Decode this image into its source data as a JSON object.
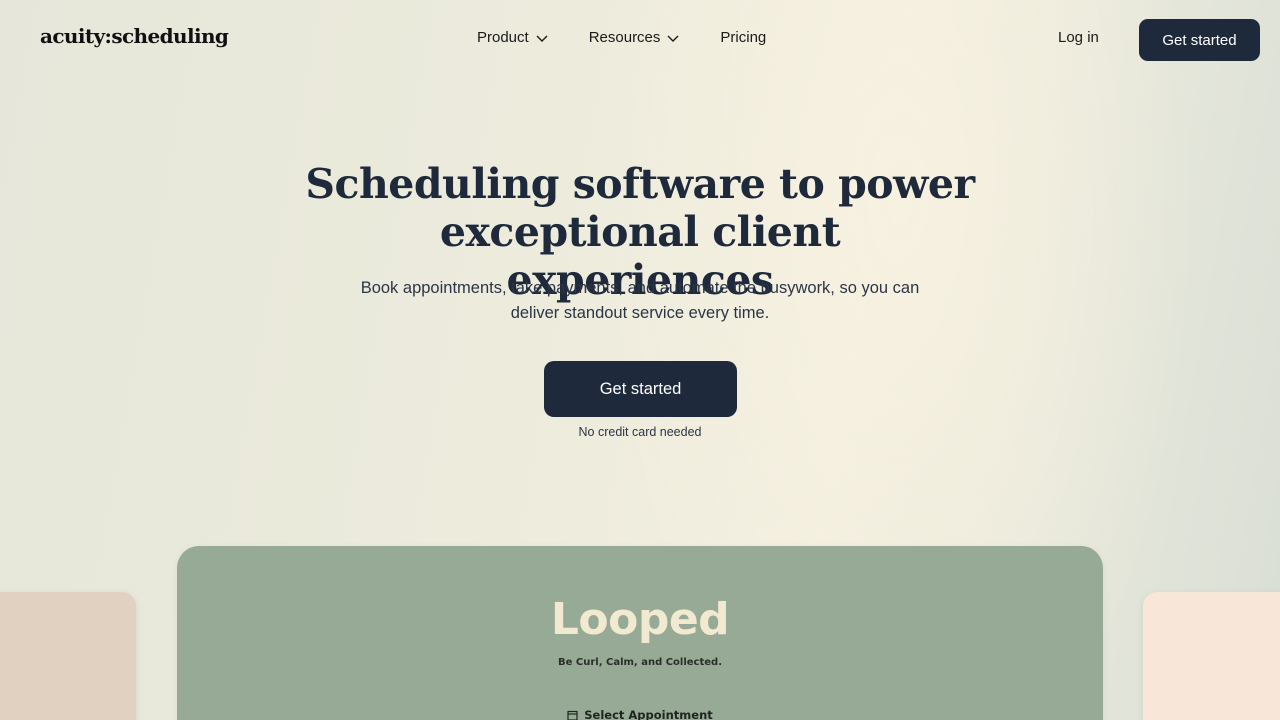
{
  "header": {
    "logo": "acuity:scheduling",
    "nav": [
      {
        "label": "Product",
        "icon": "chevron-down-icon"
      },
      {
        "label": "Resources",
        "icon": "chevron-down-icon"
      },
      {
        "label": "Pricing"
      }
    ],
    "login_label": "Log in",
    "cta_label": "Get started"
  },
  "hero": {
    "title_line1": "Scheduling software to power",
    "title_line2": "exceptional client experiences",
    "subtitle_line1": "Book appointments, take payments, and automate the busywork, so you can",
    "subtitle_line2": "deliver standout service every time.",
    "cta_label": "Get started",
    "note": "No credit card needed"
  },
  "showcase": {
    "brand_name": "Looped",
    "tagline": "Be Curl, Calm, and Collected.",
    "select_label": "Select Appointment"
  },
  "colors": {
    "primary_button": "#1e2a3c",
    "card_main": "#97aa96",
    "card_left": "#e0d1c0",
    "card_right": "#f8e6d8",
    "brand_text": "#f2ead0"
  }
}
